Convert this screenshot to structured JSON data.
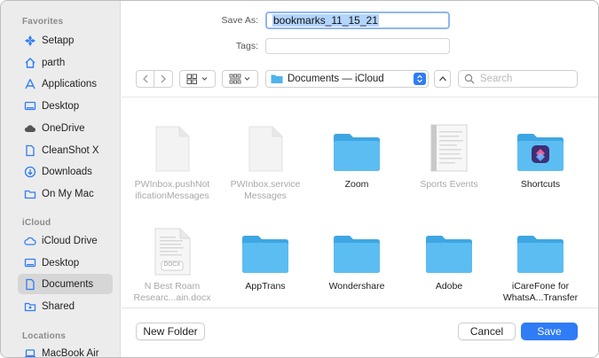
{
  "sidebar": {
    "favorites_label": "Favorites",
    "favorites": [
      {
        "label": "Setapp",
        "icon": "setapp-icon"
      },
      {
        "label": "parth",
        "icon": "home-icon"
      },
      {
        "label": "Applications",
        "icon": "applications-icon"
      },
      {
        "label": "Desktop",
        "icon": "desktop-icon"
      },
      {
        "label": "OneDrive",
        "icon": "cloud-filled-icon"
      },
      {
        "label": "CleanShot X",
        "icon": "document-icon"
      },
      {
        "label": "Downloads",
        "icon": "download-icon"
      },
      {
        "label": "On My Mac",
        "icon": "folder-icon"
      }
    ],
    "icloud_label": "iCloud",
    "icloud": [
      {
        "label": "iCloud Drive",
        "icon": "cloud-icon"
      },
      {
        "label": "Desktop",
        "icon": "desktop-icon"
      },
      {
        "label": "Documents",
        "icon": "document-icon",
        "selected": true
      },
      {
        "label": "Shared",
        "icon": "shared-folder-icon"
      }
    ],
    "locations_label": "Locations",
    "locations": [
      {
        "label": "MacBook Air",
        "icon": "laptop-icon"
      }
    ]
  },
  "form": {
    "save_as_label": "Save As:",
    "save_as_value": "bookmarks_11_15_21",
    "tags_label": "Tags:",
    "tags_value": ""
  },
  "toolbar": {
    "location": "Documents — iCloud",
    "search_placeholder": "Search"
  },
  "files": [
    {
      "name": "PWInbox.pushNotificationMessages",
      "line1": "PWInbox.pushNot",
      "line2": "ificationMessages",
      "kind": "blank",
      "disabled": true
    },
    {
      "name": "PWInbox.serviceMessages",
      "line1": "PWInbox.service",
      "line2": "Messages",
      "kind": "blank",
      "disabled": true
    },
    {
      "name": "Zoom",
      "line1": "Zoom",
      "line2": "",
      "kind": "folder",
      "disabled": false
    },
    {
      "name": "Sports Events",
      "line1": "Sports Events",
      "line2": "",
      "kind": "doc",
      "disabled": true
    },
    {
      "name": "Shortcuts",
      "line1": "Shortcuts",
      "line2": "",
      "kind": "shortcuts-folder",
      "disabled": false
    },
    {
      "name": "N Best Roam Research...ain.docx",
      "line1": "N Best Roam",
      "line2": "Researc...ain.docx",
      "kind": "docx",
      "disabled": true,
      "badge": "DOCX"
    },
    {
      "name": "AppTrans",
      "line1": "AppTrans",
      "line2": "",
      "kind": "folder",
      "disabled": false
    },
    {
      "name": "Wondershare",
      "line1": "Wondershare",
      "line2": "",
      "kind": "folder",
      "disabled": false
    },
    {
      "name": "Adobe",
      "line1": "Adobe",
      "line2": "",
      "kind": "folder",
      "disabled": false
    },
    {
      "name": "iCareFone for WhatsA...Transfer",
      "line1": "iCareFone for",
      "line2": "WhatsA...Transfer",
      "kind": "folder",
      "disabled": false
    }
  ],
  "buttons": {
    "new_folder": "New Folder",
    "cancel": "Cancel",
    "save": "Save"
  },
  "colors": {
    "accent": "#2f7cf6",
    "folder": "#4fb3ec"
  }
}
